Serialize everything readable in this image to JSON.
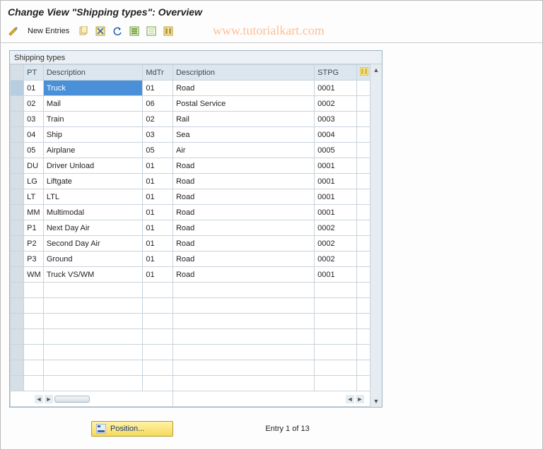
{
  "title": "Change View \"Shipping types\": Overview",
  "watermark": "www.tutorialkart.com",
  "toolbar": {
    "new_entries": "New Entries"
  },
  "panel_title": "Shipping types",
  "columns": {
    "pt": "PT",
    "desc": "Description",
    "mdtr": "MdTr",
    "desc2": "Description",
    "stpg": "STPG"
  },
  "rows": [
    {
      "pt": "01",
      "desc": "Truck",
      "mdtr": "01",
      "desc2": "Road",
      "stpg": "0001",
      "selected": true
    },
    {
      "pt": "02",
      "desc": "Mail",
      "mdtr": "06",
      "desc2": "Postal Service",
      "stpg": "0002"
    },
    {
      "pt": "03",
      "desc": "Train",
      "mdtr": "02",
      "desc2": "Rail",
      "stpg": "0003"
    },
    {
      "pt": "04",
      "desc": "Ship",
      "mdtr": "03",
      "desc2": "Sea",
      "stpg": "0004"
    },
    {
      "pt": "05",
      "desc": "Airplane",
      "mdtr": "05",
      "desc2": "Air",
      "stpg": "0005"
    },
    {
      "pt": "DU",
      "desc": "Driver Unload",
      "mdtr": "01",
      "desc2": "Road",
      "stpg": "0001"
    },
    {
      "pt": "LG",
      "desc": "Liftgate",
      "mdtr": "01",
      "desc2": "Road",
      "stpg": "0001"
    },
    {
      "pt": "LT",
      "desc": "LTL",
      "mdtr": "01",
      "desc2": "Road",
      "stpg": "0001"
    },
    {
      "pt": "MM",
      "desc": "Multimodal",
      "mdtr": "01",
      "desc2": "Road",
      "stpg": "0001"
    },
    {
      "pt": "P1",
      "desc": "Next Day Air",
      "mdtr": "01",
      "desc2": "Road",
      "stpg": "0002"
    },
    {
      "pt": "P2",
      "desc": "Second Day Air",
      "mdtr": "01",
      "desc2": "Road",
      "stpg": "0002"
    },
    {
      "pt": "P3",
      "desc": "Ground",
      "mdtr": "01",
      "desc2": "Road",
      "stpg": "0002"
    },
    {
      "pt": "WM",
      "desc": "Truck VS/WM",
      "mdtr": "01",
      "desc2": "Road",
      "stpg": "0001"
    }
  ],
  "empty_rows": 7,
  "footer": {
    "position_label": "Position...",
    "entry_text": "Entry 1 of 13"
  }
}
